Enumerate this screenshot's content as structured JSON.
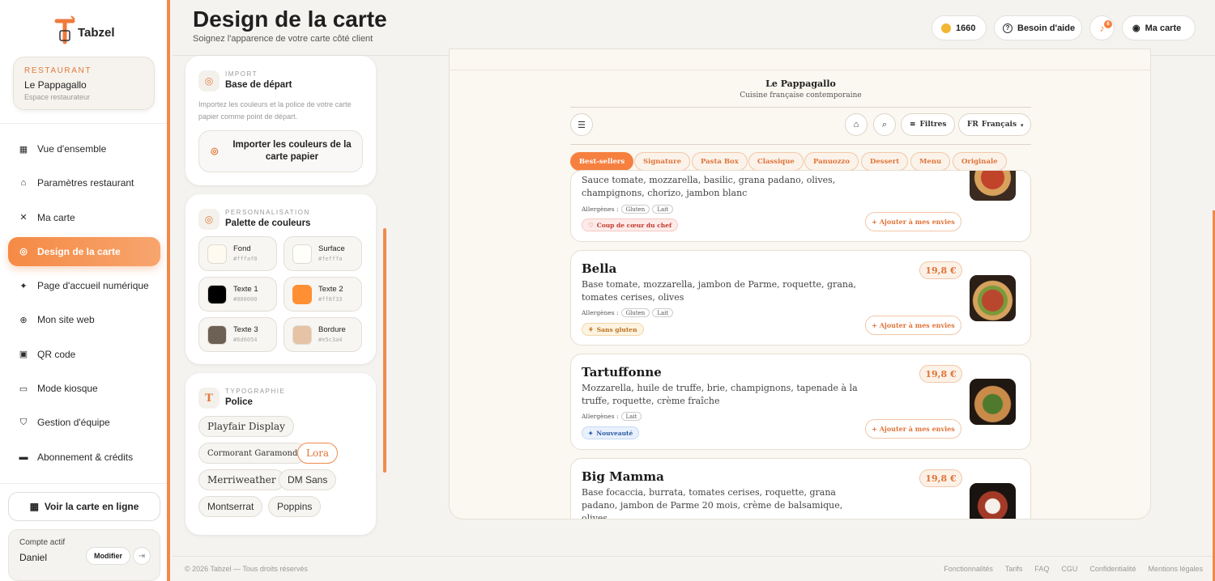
{
  "brand": {
    "name": "Tabzel"
  },
  "restaurant": {
    "kicker": "RESTAURANT",
    "name": "Le Pappagallo",
    "role": "Espace restaurateur"
  },
  "nav": [
    {
      "label": "Vue d'ensemble",
      "icon": "grid-icon"
    },
    {
      "label": "Paramètres restaurant",
      "icon": "store-icon"
    },
    {
      "label": "Ma carte",
      "icon": "utensils-icon"
    },
    {
      "label": "Design de la carte",
      "icon": "palette-icon",
      "active": true
    },
    {
      "label": "Page d'accueil numérique",
      "icon": "sparkle-icon"
    },
    {
      "label": "Mon site web",
      "icon": "globe-icon"
    },
    {
      "label": "QR code",
      "icon": "qr-icon"
    },
    {
      "label": "Mode kiosque",
      "icon": "monitor-icon"
    },
    {
      "label": "Gestion d'équipe",
      "icon": "shield-icon"
    },
    {
      "label": "Abonnement & crédits",
      "icon": "card-icon"
    }
  ],
  "view_online": "Voir la carte en ligne",
  "account": {
    "label": "Compte actif",
    "name": "Daniel",
    "edit": "Modifier"
  },
  "page": {
    "title": "Design de la carte",
    "subtitle": "Soignez l'apparence de votre carte côté client"
  },
  "header": {
    "credits": "1660",
    "help": "Besoin d'aide",
    "notifications": "6",
    "my_menu": "Ma carte"
  },
  "import_panel": {
    "kicker": "IMPORT",
    "title": "Base de départ",
    "desc": "Importez les couleurs et la police de votre carte papier comme point de départ.",
    "button": "Importer les couleurs de la carte papier"
  },
  "palette_panel": {
    "kicker": "PERSONNALISATION",
    "title": "Palette de couleurs",
    "swatches": [
      {
        "name": "Fond",
        "hex": "#fffaf0"
      },
      {
        "name": "Surface",
        "hex": "#fefffa"
      },
      {
        "name": "Texte 1",
        "hex": "#000000"
      },
      {
        "name": "Texte 2",
        "hex": "#ff8f33"
      },
      {
        "name": "Texte 3",
        "hex": "#6d6054"
      },
      {
        "name": "Bordure",
        "hex": "#e5c3a4"
      }
    ]
  },
  "typo_panel": {
    "kicker": "TYPOGRAPHIE",
    "title": "Police",
    "fonts": [
      "Playfair Display",
      "Cormorant Garamond",
      "Lora",
      "Merriweather",
      "DM Sans",
      "Montserrat",
      "Poppins"
    ],
    "selected": "Lora"
  },
  "preview": {
    "restaurant": "Le Pappagallo",
    "tagline": "Cuisine française contemporaine",
    "filters": "Filtres",
    "lang_code": "FR",
    "lang": "Français",
    "categories": [
      "Best-sellers",
      "Signature",
      "Pasta Box",
      "Classique",
      "Panuozzo",
      "Dessert",
      "Menu",
      "Originale"
    ],
    "allergens_label": "Allergènes :",
    "wish_label": "+ Ajouter à mes envies",
    "partial_desc": "Sauce tomate, mozzarella, basilic, grana padano, olives, champignons, chorizo, jambon blanc",
    "partial_allergens": [
      "Gluten",
      "Lait"
    ],
    "partial_badge": "Coup de cœur du chef",
    "items": [
      {
        "name": "Bella",
        "price": "19,8 €",
        "desc": "Base tomate, mozzarella, jambon de Parme, roquette, grana, tomates cerises, olives",
        "allergens": [
          "Gluten",
          "Lait"
        ],
        "badge": "Sans gluten"
      },
      {
        "name": "Tartuffonne",
        "price": "19,8 €",
        "desc": "Mozzarella, huile de truffe, brie, champignons, tapenade à la truffe, roquette, crème fraîche",
        "allergens": [
          "Lait"
        ],
        "badge": "Nouveauté"
      },
      {
        "name": "Big Mamma",
        "price": "19,8 €",
        "desc": "Base focaccia, burrata, tomates cerises, roquette, grana padano, jambon de Parme 20 mois, crème de balsamique, olives"
      }
    ]
  },
  "footer": {
    "copyright": "© 2026 Tabzel — Tous droits réservés",
    "links": [
      "Fonctionnalités",
      "Tarifs",
      "FAQ",
      "CGU",
      "Confidentialité",
      "Mentions légales"
    ]
  }
}
